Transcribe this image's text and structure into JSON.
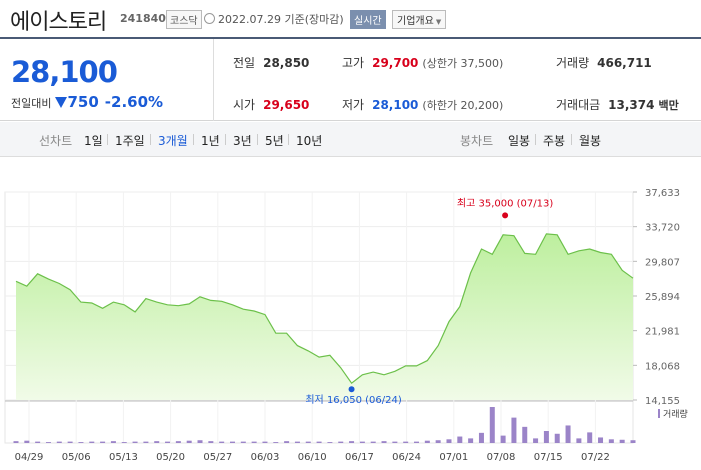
{
  "header": {
    "name": "에이스토리",
    "code": "241840",
    "market": "코스닥",
    "date": "2022.07.29 기준(장마감)",
    "live_label": "실시간",
    "info_label": "기업개요"
  },
  "quote": {
    "price": "28,100",
    "change_label": "전일대비",
    "change": "750",
    "change_pct": "-2.60%",
    "prev_label": "전일",
    "prev": "28,850",
    "high_label": "고가",
    "high": "29,700",
    "upper_limit": "(상한가 37,500)",
    "volume_label": "거래량",
    "volume": "466,711",
    "open_label": "시가",
    "open": "29,650",
    "low_label": "저가",
    "low": "28,100",
    "lower_limit": "(하한가 20,200)",
    "amount_label": "거래대금",
    "amount": "13,374",
    "amount_unit": "백만"
  },
  "tabs": {
    "line_label": "선차트",
    "periods": [
      "1일",
      "1주일",
      "3개월",
      "1년",
      "3년",
      "5년",
      "10년"
    ],
    "selected": "3개월",
    "candle_label": "봉차트",
    "candles": [
      "일봉",
      "주봉",
      "월봉"
    ]
  },
  "colors": {
    "up": "#d8001b",
    "down": "#1a5bd6",
    "line": "#6cc04a",
    "volume": "#9b84c8"
  },
  "chart_data": {
    "type": "area",
    "title": "",
    "ylim": [
      14155,
      37633
    ],
    "yticks": [
      "37,633",
      "33,720",
      "29,807",
      "25,894",
      "21,981",
      "18,068",
      "14,155"
    ],
    "xtick_labels": [
      "04/29",
      "05/06",
      "05/13",
      "05/20",
      "05/27",
      "06/03",
      "06/10",
      "06/17",
      "06/24",
      "07/01",
      "07/08",
      "07/15",
      "07/22"
    ],
    "prices": [
      27550,
      27000,
      28400,
      27800,
      27300,
      26600,
      25200,
      25100,
      24500,
      25200,
      24900,
      24100,
      25600,
      25200,
      24900,
      24800,
      25000,
      25800,
      25400,
      25300,
      24900,
      24400,
      24200,
      23800,
      21700,
      21700,
      20300,
      19700,
      19000,
      19200,
      17800,
      16050,
      17000,
      17300,
      17000,
      17400,
      18000,
      18000,
      18600,
      20300,
      23000,
      24700,
      28500,
      31200,
      30600,
      32800,
      32700,
      30700,
      30600,
      32900,
      32800,
      30600,
      31000,
      31200,
      30800,
      30600,
      28800,
      27900
    ],
    "volumes": [
      4,
      5,
      3,
      2,
      3,
      3,
      2,
      3,
      3,
      4,
      2,
      3,
      3,
      4,
      3,
      4,
      5,
      6,
      4,
      3,
      3,
      3,
      3,
      3,
      2,
      4,
      3,
      3,
      3,
      2,
      3,
      4,
      3,
      3,
      4,
      3,
      3,
      3,
      5,
      6,
      8,
      14,
      10,
      22,
      78,
      16,
      55,
      35,
      10,
      26,
      20,
      38,
      10,
      23,
      12,
      8,
      7,
      6
    ],
    "volume_label": "거래량",
    "max": {
      "label": "최고",
      "value": "35,000",
      "date": "(07/13)",
      "price": 35000,
      "index": 45
    },
    "min": {
      "label": "최저",
      "value": "16,050",
      "date": "(06/24)",
      "price": 16050,
      "index": 31
    }
  }
}
